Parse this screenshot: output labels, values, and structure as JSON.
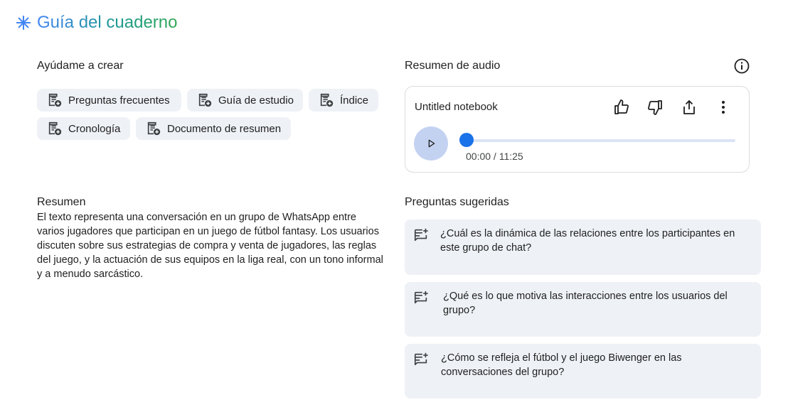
{
  "header": {
    "title": "Guía del cuaderno",
    "icon": "sparkle-icon"
  },
  "help_create": {
    "label": "Ayúdame a crear",
    "chips": [
      {
        "label": "Preguntas frecuentes",
        "icon": "note-add-icon"
      },
      {
        "label": "Guía de estudio",
        "icon": "note-add-icon"
      },
      {
        "label": "Índice",
        "icon": "note-add-icon"
      },
      {
        "label": "Cronología",
        "icon": "note-add-icon"
      },
      {
        "label": "Documento de resumen",
        "icon": "note-add-icon"
      }
    ]
  },
  "audio": {
    "label": "Resumen de audio",
    "notebook_title": "Untitled notebook",
    "current_time": "00:00",
    "total_time": "11:25",
    "progress": 0,
    "time_display": "00:00 / 11:25"
  },
  "summary": {
    "label": "Resumen",
    "text": "El texto representa una conversación en un grupo de WhatsApp entre varios jugadores que participan en un juego de fútbol fantasy. Los usuarios discuten sobre sus estrategias de compra y venta de jugadores, las reglas del juego, y la actuación de sus equipos en la liga real, con un tono informal y a menudo sarcástico."
  },
  "suggested": {
    "label": "Preguntas sugeridas",
    "questions": [
      {
        "text": "¿Cuál es la dinámica de las relaciones entre los participantes en este grupo de chat?"
      },
      {
        "text": "¿Qué es lo que motiva las interacciones entre los usuarios del grupo?"
      },
      {
        "text": "¿Cómo se refleja el fútbol y el juego Biwenger en las conversaciones del grupo?"
      }
    ]
  },
  "colors": {
    "accent": "#1a73e8",
    "chip_bg": "#eef1f6",
    "play_bg": "#c4d2f2"
  }
}
